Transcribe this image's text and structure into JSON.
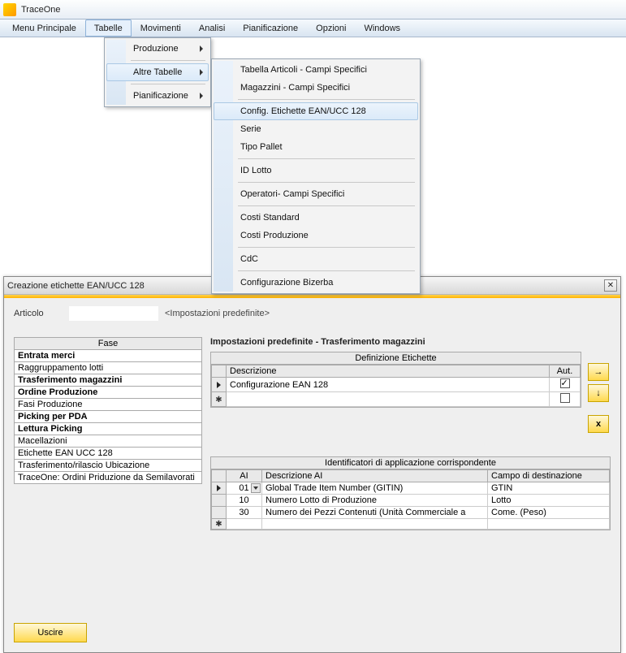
{
  "app_title": "TraceOne",
  "menubar": [
    "Menu Principale",
    "Tabelle",
    "Movimenti",
    "Analisi",
    "Pianificazione",
    "Opzioni",
    "Windows"
  ],
  "open_menu_index": 1,
  "dropdown1": {
    "items": [
      "Produzione",
      "Altre Tabelle",
      "Pianificazione"
    ],
    "highlight_index": 1
  },
  "dropdown2": {
    "groups": [
      [
        "Tabella Articoli - Campi Specifici",
        "Magazzini - Campi Specifici"
      ],
      [
        "Config. Etichette EAN/UCC 128",
        "Serie",
        "Tipo Pallet"
      ],
      [
        "ID Lotto"
      ],
      [
        "Operatori- Campi Specifici"
      ],
      [
        "Costi Standard",
        "Costi Produzione"
      ],
      [
        "CdC"
      ],
      [
        "Configurazione Bizerba"
      ]
    ],
    "highlight": "Config. Etichette EAN/UCC 128"
  },
  "dialog": {
    "title": "Creazione etichette EAN/UCC 128",
    "articolo_label": "Articolo",
    "info_text": "<Impostazioni predefinite>",
    "section_title": "Impostazioni predefinite - Trasferimento magazzini",
    "phase_header": "Fase",
    "phases": [
      {
        "label": "Entrata merci",
        "bold": true
      },
      {
        "label": "Raggruppamento lotti",
        "bold": false
      },
      {
        "label": "Trasferimento magazzini",
        "bold": true
      },
      {
        "label": "Ordine Produzione",
        "bold": true
      },
      {
        "label": "Fasi Produzione",
        "bold": false
      },
      {
        "label": "Picking per PDA",
        "bold": true
      },
      {
        "label": "Lettura Picking",
        "bold": true
      },
      {
        "label": "Macellazioni",
        "bold": false
      },
      {
        "label": "Etichette EAN UCC 128",
        "bold": false
      },
      {
        "label": "Trasferimento/rilascio Ubicazione",
        "bold": false
      },
      {
        "label": "TraceOne: Ordini Priduzione da Semilavorati",
        "bold": false
      }
    ],
    "grid1": {
      "caption": "Definizione Etichette",
      "col_descr": "Descrizione",
      "col_aut": "Aut.",
      "rows": [
        {
          "descr": "Configurazione EAN 128",
          "aut": true
        },
        {
          "descr": "",
          "aut": false
        }
      ]
    },
    "side_icons": {
      "right": "→",
      "down": "↓",
      "del": "x"
    },
    "grid2": {
      "caption": "Identificatori di applicazione corrispondente",
      "col_ai": "AI",
      "col_descr": "Descrizione AI",
      "col_campo": "Campo di destinazione",
      "rows": [
        {
          "ai": "01",
          "descr": "Global Trade Item Number (GITIN)",
          "campo": "GTIN",
          "combo": true,
          "ptr": true
        },
        {
          "ai": "10",
          "descr": "Numero Lotto di Produzione",
          "campo": "Lotto"
        },
        {
          "ai": "30",
          "descr": "Numero dei Pezzi Contenuti (Unità Commerciale a",
          "campo": "Come.  (Peso)"
        }
      ]
    },
    "exit_label": "Uscire"
  }
}
